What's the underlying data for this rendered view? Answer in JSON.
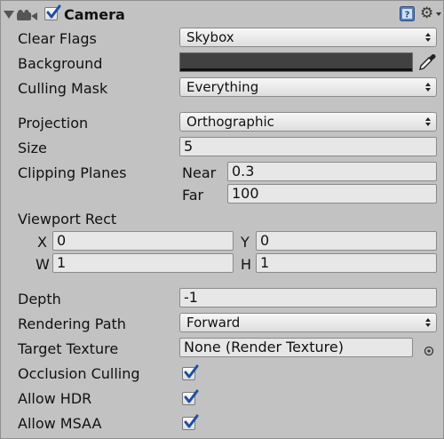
{
  "component": {
    "title": "Camera",
    "enabled": true,
    "icons": [
      "foldout-arrow-icon",
      "camera-icon",
      "help-book-icon",
      "gear-icon"
    ]
  },
  "fields": {
    "clear_flags": {
      "label": "Clear Flags",
      "value": "Skybox"
    },
    "background": {
      "label": "Background",
      "color": "#414141"
    },
    "culling_mask": {
      "label": "Culling Mask",
      "value": "Everything"
    },
    "projection": {
      "label": "Projection",
      "value": "Orthographic"
    },
    "size": {
      "label": "Size",
      "value": "5"
    },
    "clipping_planes": {
      "label": "Clipping Planes",
      "near_label": "Near",
      "near_value": "0.3",
      "far_label": "Far",
      "far_value": "100"
    },
    "viewport_rect": {
      "label": "Viewport Rect",
      "x_label": "X",
      "x_value": "0",
      "y_label": "Y",
      "y_value": "0",
      "w_label": "W",
      "w_value": "1",
      "h_label": "H",
      "h_value": "1"
    },
    "depth": {
      "label": "Depth",
      "value": "-1"
    },
    "rendering_path": {
      "label": "Rendering Path",
      "value": "Forward"
    },
    "target_texture": {
      "label": "Target Texture",
      "value": "None (Render Texture)"
    },
    "occlusion_culling": {
      "label": "Occlusion Culling",
      "checked": true
    },
    "allow_hdr": {
      "label": "Allow HDR",
      "checked": true
    },
    "allow_msaa": {
      "label": "Allow MSAA",
      "checked": true
    }
  },
  "colors": {
    "panel_bg": "#c2c2c2",
    "field_bg": "#e7e7e7",
    "check_accent": "#1f4fa0"
  }
}
